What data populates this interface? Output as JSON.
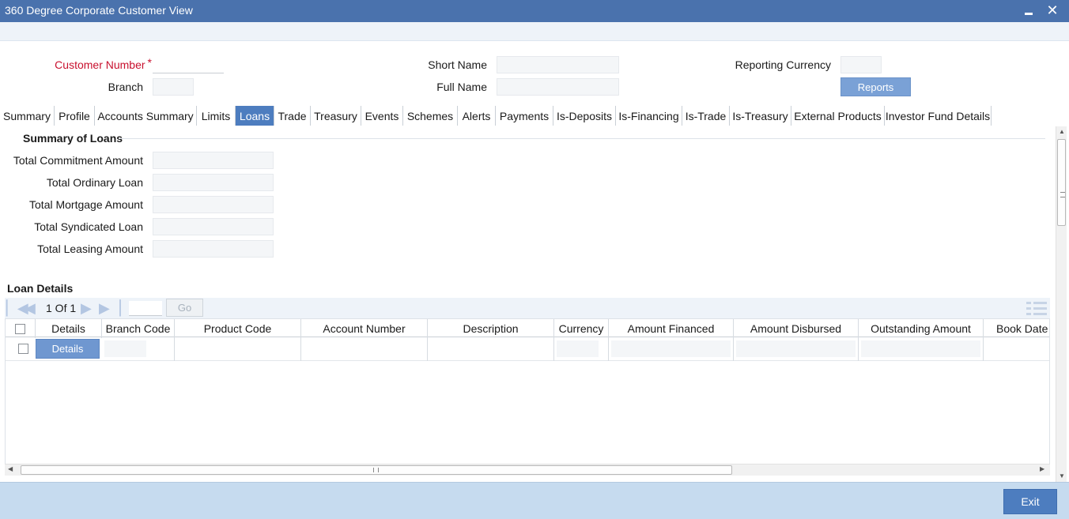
{
  "window": {
    "title": "360 Degree Corporate Customer View"
  },
  "header": {
    "customer_number_label": "Customer Number",
    "required_marker": "*",
    "branch_label": "Branch",
    "short_name_label": "Short Name",
    "full_name_label": "Full Name",
    "reporting_currency_label": "Reporting Currency",
    "reports_button": "Reports"
  },
  "tabs": [
    {
      "label": "Summary"
    },
    {
      "label": "Profile"
    },
    {
      "label": "Accounts Summary"
    },
    {
      "label": "Limits"
    },
    {
      "label": "Loans",
      "active": true
    },
    {
      "label": "Trade"
    },
    {
      "label": "Treasury"
    },
    {
      "label": "Events"
    },
    {
      "label": "Schemes"
    },
    {
      "label": "Alerts"
    },
    {
      "label": "Payments"
    },
    {
      "label": "Is-Deposits"
    },
    {
      "label": "Is-Financing"
    },
    {
      "label": "Is-Trade"
    },
    {
      "label": "Is-Treasury"
    },
    {
      "label": "External Products"
    },
    {
      "label": "Investor Fund Details"
    }
  ],
  "summary": {
    "title": "Summary of Loans",
    "fields": [
      {
        "label": "Total Commitment Amount"
      },
      {
        "label": "Total Ordinary Loan"
      },
      {
        "label": "Total Mortgage Amount"
      },
      {
        "label": "Total Syndicated Loan"
      },
      {
        "label": "Total Leasing Amount"
      }
    ]
  },
  "loan_details": {
    "title": "Loan Details",
    "pager": {
      "page_text": "1 Of 1",
      "go_button": "Go"
    },
    "columns": [
      "Details",
      "Branch Code",
      "Product Code",
      "Account Number",
      "Description",
      "Currency",
      "Amount Financed",
      "Amount Disbursed",
      "Outstanding Amount",
      "Book Date"
    ],
    "row_details_button": "Details"
  },
  "footer": {
    "exit_button": "Exit"
  },
  "colors": {
    "titlebar": "#4a72ad",
    "active_tab": "#4d7dbf",
    "footer": "#c6dbef",
    "required": "#c8102e"
  }
}
